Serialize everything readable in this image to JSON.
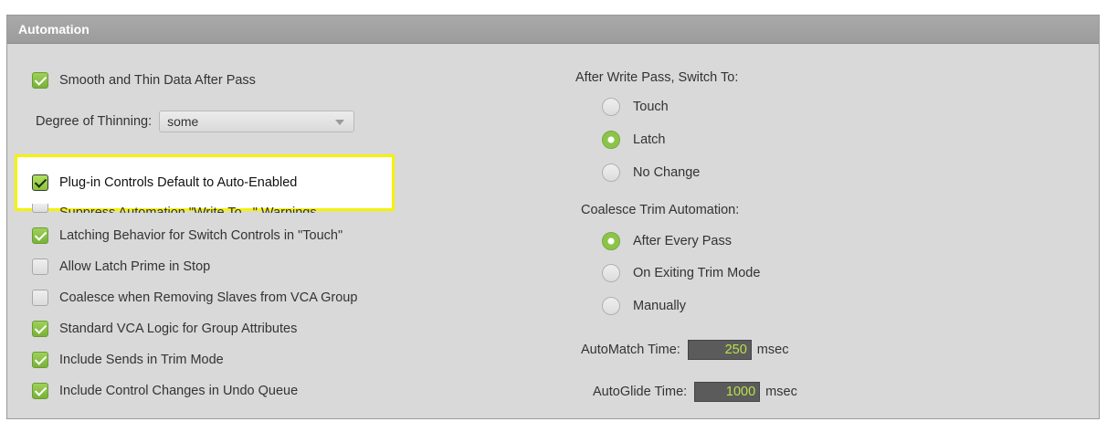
{
  "panel": {
    "title": "Automation"
  },
  "left": {
    "smooth_thin": {
      "label": "Smooth and Thin Data After Pass",
      "checked": true
    },
    "degree_of_thinning": {
      "label": "Degree of Thinning:",
      "value": "some"
    },
    "plugin_controls": {
      "label": "Plug-in Controls Default to Auto-Enabled",
      "checked": true
    },
    "suppress_warnings": {
      "label": "Suppress Automation \"Write To...\" Warnings",
      "checked": false
    },
    "latching_behavior": {
      "label": "Latching Behavior for Switch Controls in \"Touch\"",
      "checked": true
    },
    "latch_prime": {
      "label": "Allow Latch Prime in Stop",
      "checked": false
    },
    "coalesce_slaves": {
      "label": "Coalesce when Removing Slaves from VCA Group",
      "checked": false
    },
    "standard_vca": {
      "label": "Standard VCA Logic for Group Attributes",
      "checked": true
    },
    "sends_trim": {
      "label": "Include Sends in Trim Mode",
      "checked": true
    },
    "control_changes": {
      "label": "Include Control Changes in Undo Queue",
      "checked": true
    }
  },
  "right": {
    "after_write_label": "After Write Pass, Switch To:",
    "after_write_options": [
      {
        "label": "Touch",
        "selected": false
      },
      {
        "label": "Latch",
        "selected": true
      },
      {
        "label": "No Change",
        "selected": false
      }
    ],
    "coalesce_label": "Coalesce Trim Automation:",
    "coalesce_options": [
      {
        "label": "After Every Pass",
        "selected": true
      },
      {
        "label": "On Exiting Trim Mode",
        "selected": false
      },
      {
        "label": "Manually",
        "selected": false
      }
    ],
    "automatch": {
      "label": "AutoMatch Time:",
      "value": "250",
      "unit": "msec"
    },
    "autoglide": {
      "label": "AutoGlide Time:",
      "value": "1000",
      "unit": "msec"
    }
  },
  "colors": {
    "accent_green": "#8cc447",
    "highlight_yellow": "#f5f200",
    "value_text": "#b8e04a"
  }
}
